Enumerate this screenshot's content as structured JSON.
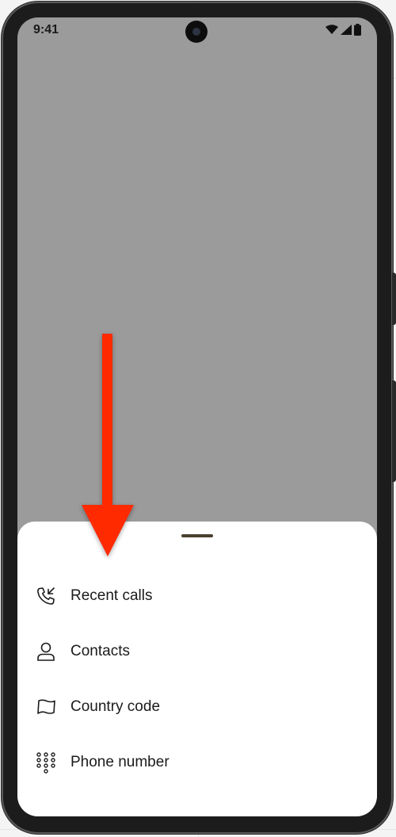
{
  "status_bar": {
    "time": "9:41",
    "icons": [
      "wifi-icon",
      "cellular-signal-icon",
      "battery-icon"
    ]
  },
  "bottom_sheet": {
    "items": [
      {
        "label": "Recent calls",
        "icon": "recent-calls-icon"
      },
      {
        "label": "Contacts",
        "icon": "person-icon"
      },
      {
        "label": "Country code",
        "icon": "flag-icon"
      },
      {
        "label": "Phone number",
        "icon": "dialpad-icon"
      }
    ]
  },
  "annotation": {
    "arrow_color": "#ff2a00",
    "direction": "down"
  },
  "colors": {
    "scrim": "#9b9b9b",
    "sheet_background": "#ffffff",
    "handle": "#4a4030",
    "text": "#1b1b1b"
  }
}
